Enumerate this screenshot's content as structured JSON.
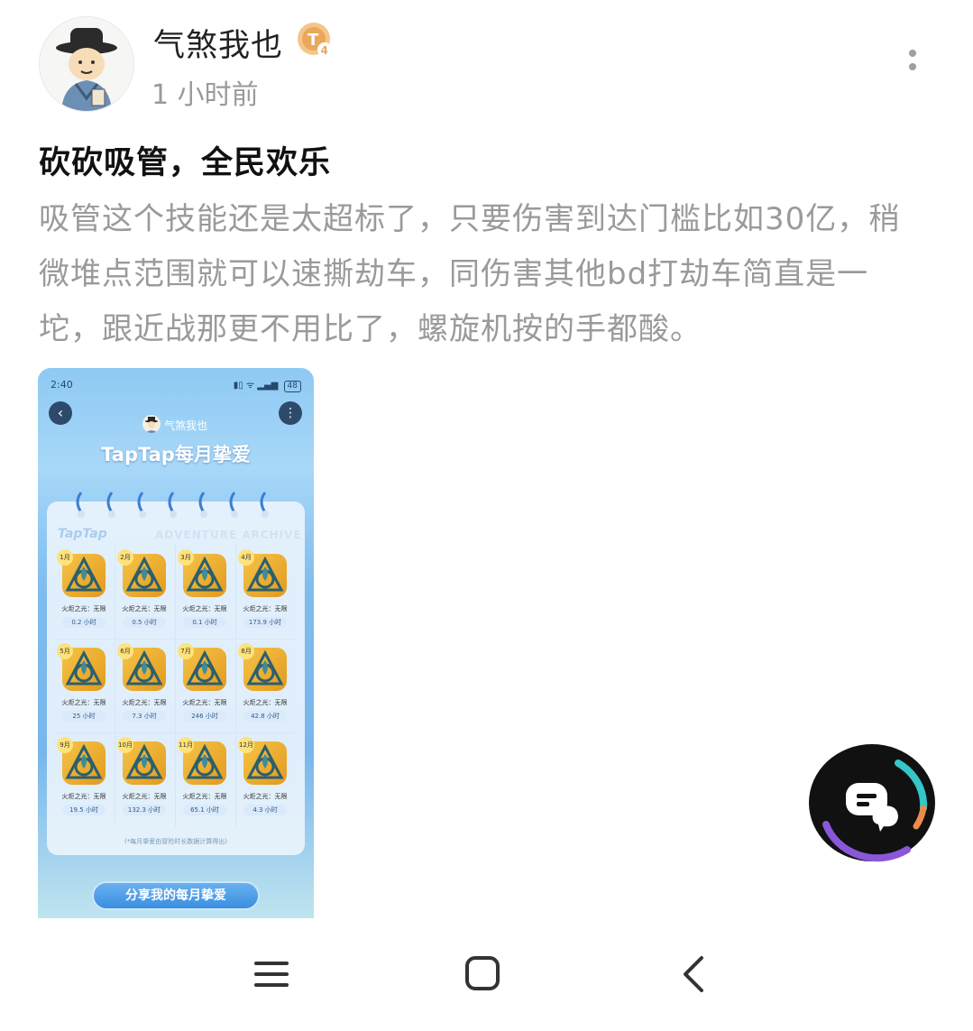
{
  "post": {
    "author": "气煞我也",
    "level_badge": "4",
    "time": "1 小时前",
    "title": "砍砍吸管，全民欢乐",
    "body": "吸管这个技能还是太超标了，只要伤害到达门槛比如30亿，稍微堆点范围就可以速撕劫车，同伤害其他bd打劫车简直是一坨，跟近战那更不用比了，螺旋机按的手都酸。"
  },
  "screenshot": {
    "status_time": "2:40",
    "status_battery": "48",
    "username": "气煞我也",
    "title": "TapTap每月挚爱",
    "logo": "TapTap",
    "subtitle": "ADVENTURE ARCHIVE",
    "months": [
      {
        "month": "1月",
        "game": "火炬之光：无限",
        "hours": "0.2 小时"
      },
      {
        "month": "2月",
        "game": "火炬之光：无限",
        "hours": "0.5 小时"
      },
      {
        "month": "3月",
        "game": "火炬之光：无限",
        "hours": "0.1 小时"
      },
      {
        "month": "4月",
        "game": "火炬之光：无限",
        "hours": "173.9 小时"
      },
      {
        "month": "5月",
        "game": "火炬之光：无限",
        "hours": "25 小时"
      },
      {
        "month": "6月",
        "game": "火炬之光：无限",
        "hours": "7.3 小时"
      },
      {
        "month": "7月",
        "game": "火炬之光：无限",
        "hours": "246 小时"
      },
      {
        "month": "8月",
        "game": "火炬之光：无限",
        "hours": "42.8 小时"
      },
      {
        "month": "9月",
        "game": "火炬之光：无限",
        "hours": "19.5 小时"
      },
      {
        "month": "10月",
        "game": "火炬之光：无限",
        "hours": "132.3 小时"
      },
      {
        "month": "11月",
        "game": "火炬之光：无限",
        "hours": "65.1 小时"
      },
      {
        "month": "12月",
        "game": "火炬之光：无限",
        "hours": "4.3 小时"
      }
    ],
    "note": "(*每月挚爱由冒险时长数据计算得出)",
    "share_button": "分享我的每月挚爱"
  },
  "icons": {
    "more": "more-vertical-icon",
    "chat": "chat-bubble-icon",
    "nav_menu": "menu-icon",
    "nav_home": "home-square-icon",
    "nav_back": "back-arrow-icon"
  }
}
